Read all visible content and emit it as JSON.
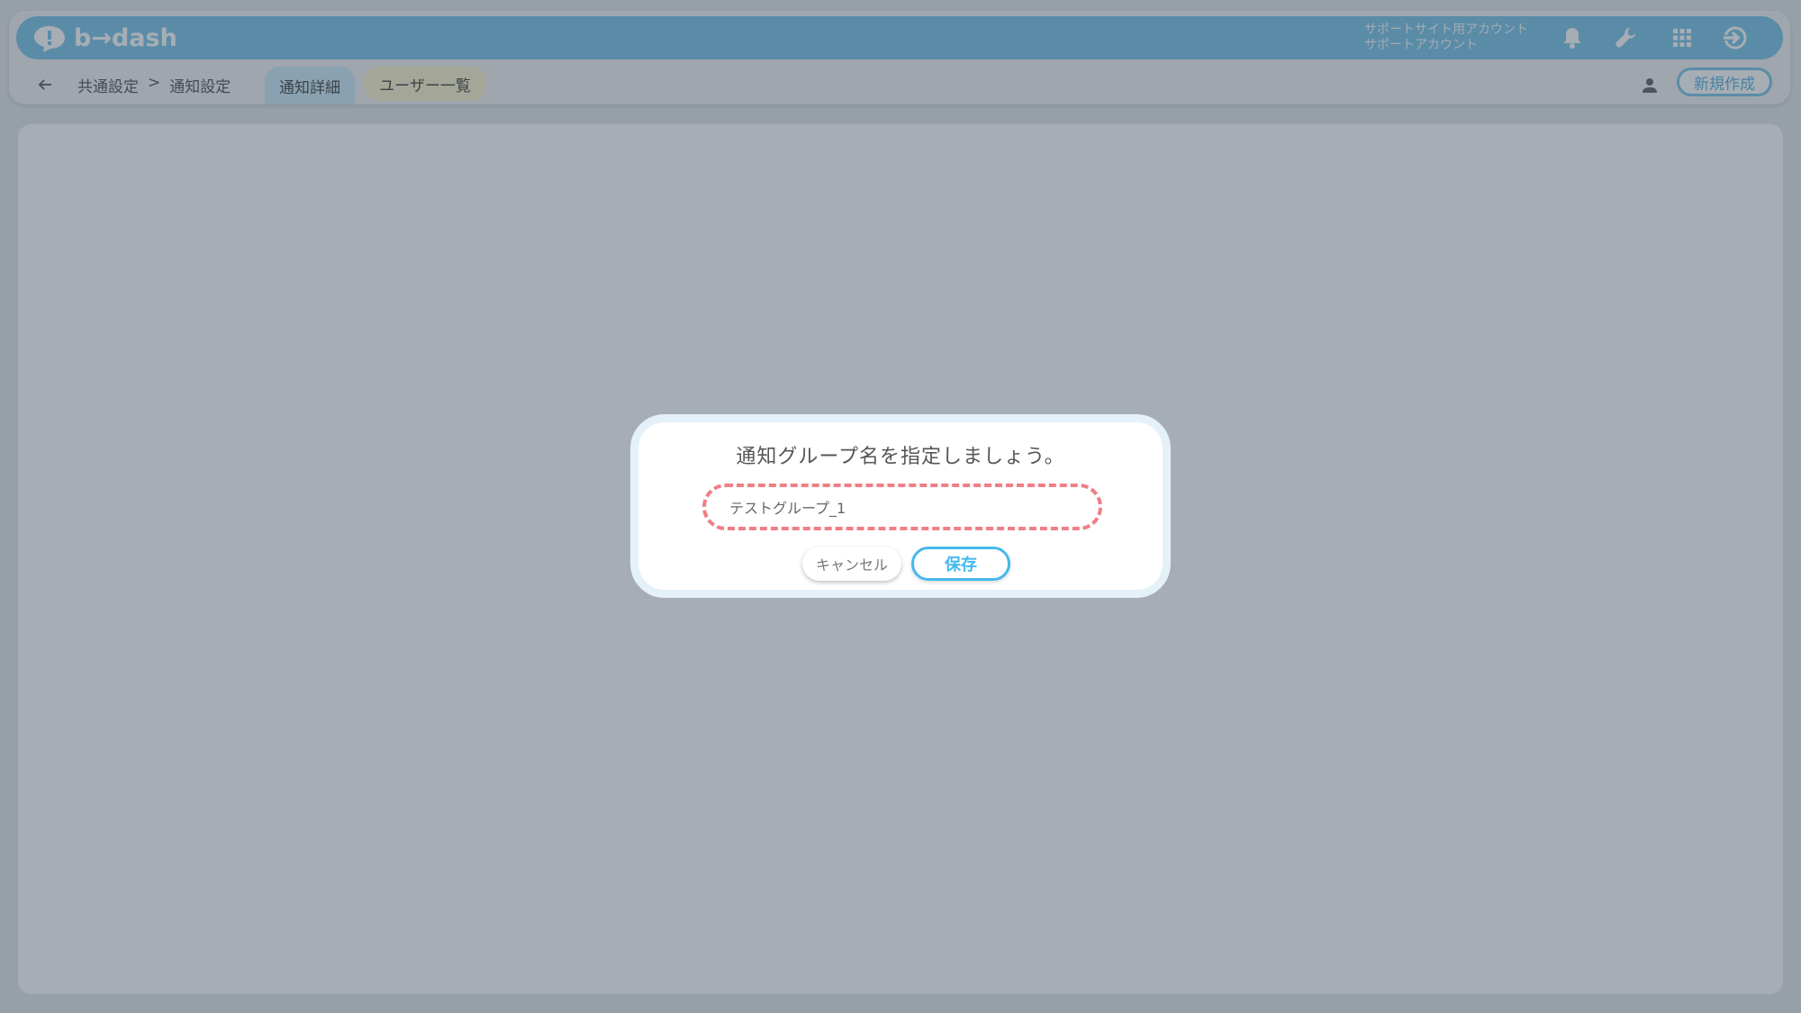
{
  "app": {
    "logo_text": "b→dash",
    "account_line1": "サポートサイト用アカウント",
    "account_line2": "サポートアカウント"
  },
  "header_icons": [
    "bell-icon",
    "wrench-icon",
    "grid-icon",
    "logout-icon"
  ],
  "breadcrumb": {
    "parent": "共通設定",
    "separator": ">",
    "current": "通知設定"
  },
  "tabs": [
    {
      "label": "通知詳細",
      "active": true
    },
    {
      "label": "ユーザー一覧",
      "active": false
    }
  ],
  "toolbar": {
    "new_label": "新規作成"
  },
  "modal": {
    "title": "通知グループ名を指定しましょう。",
    "input_value": "テストグループ_1",
    "cancel_label": "キャンセル",
    "save_label": "保存"
  },
  "colors": {
    "header": "#6fc0e6",
    "accent": "#45b8ee",
    "highlight": "#f07e86",
    "tab_active": "#c8e8f7",
    "tab_inactive": "#fbf1c8"
  }
}
